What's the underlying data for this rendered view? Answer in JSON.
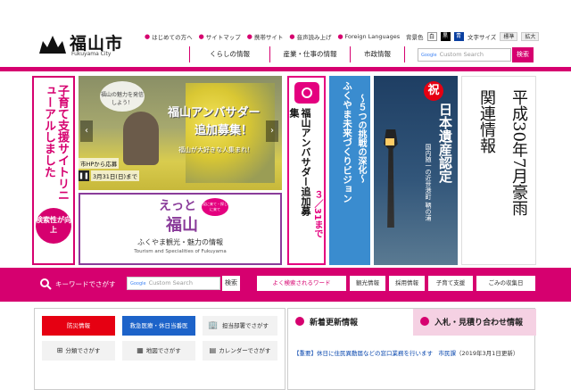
{
  "header": {
    "logo": "福山市",
    "logo_sub": "Fukuyama City"
  },
  "util_links": [
    "はじめての方へ",
    "サイトマップ",
    "携帯サイト",
    "音声読み上げ",
    "Foreign Languages"
  ],
  "color_label": "背景色",
  "colors": [
    {
      "label": "白",
      "bg": "#ffffff",
      "fg": "#000000"
    },
    {
      "label": "黒",
      "bg": "#000000",
      "fg": "#ffffff"
    },
    {
      "label": "青",
      "bg": "#0a3fa0",
      "fg": "#ffffff"
    }
  ],
  "fontsize_label": "文字サイズ",
  "fontsizes": [
    "標準",
    "拡大"
  ],
  "nav": [
    "くらしの情報",
    "産業・仕事の情報",
    "市政情報"
  ],
  "search": {
    "placeholder": "Custom Search",
    "button": "検索"
  },
  "banners": {
    "childcare": {
      "title": "子育て支援サイトリニューアルしました",
      "badge": "検索性が向上"
    },
    "ambassador": {
      "top": "福山の魅力を発信しよう！",
      "title1": "福山アンバサダー",
      "title2": "追加募集！",
      "sub": "福山が大好きな人集まれ！",
      "date1": "市HPから応募",
      "date2": "3月31日(日)まで"
    },
    "eto": {
      "logo1": "えっと",
      "logo2": "福山",
      "bubble": "見に来て・探しに来て",
      "sub": "ふくやま観光・魅力の情報",
      "en": "Tourism and Specialities of Fukuyama"
    },
    "ambassador2": {
      "title": "福山アンバサダー追加募集",
      "date": "３／31まで"
    },
    "vision": {
      "main": "ふくやま未来づくりビジョン",
      "sub": "～５つの挑戦の深化～"
    },
    "heritage": {
      "mark": "祝",
      "title": "日本遺産認定",
      "sub": "国内随一の近世港町 鞆の浦"
    },
    "flood": {
      "title": "平成30年7月豪雨",
      "sub": "関連情報"
    }
  },
  "keyword": {
    "label": "キーワードでさがす",
    "placeholder": "Custom Search",
    "button": "検索",
    "popular": "よく検索されるワード",
    "words": [
      "観光情報",
      "採用情報",
      "子育て支援",
      "ごみの収集日"
    ]
  },
  "quick": [
    {
      "label": "防災情報",
      "bg": "#e60012",
      "fg": "#ffffff"
    },
    {
      "label": "救急医療・休日当番医",
      "bg": "#1d63c9",
      "fg": "#ffffff"
    },
    {
      "label": "担当部署でさがす",
      "bg": "#f2f2f2",
      "fg": "#333333"
    },
    {
      "label": "分類でさがす",
      "bg": "#f2f2f2",
      "fg": "#333333"
    },
    {
      "label": "地図でさがす",
      "bg": "#f2f2f2",
      "fg": "#333333"
    },
    {
      "label": "カレンダーでさがす",
      "bg": "#f2f2f2",
      "fg": "#333333"
    }
  ],
  "news": {
    "tab1": "新着更新情報",
    "tab2": "入札・見積り合わせ情報",
    "item": "【重要】休日に住民異動届などの窓口業務を行います",
    "cat": "市民課",
    "date": "（2019年3月1日更新）"
  }
}
